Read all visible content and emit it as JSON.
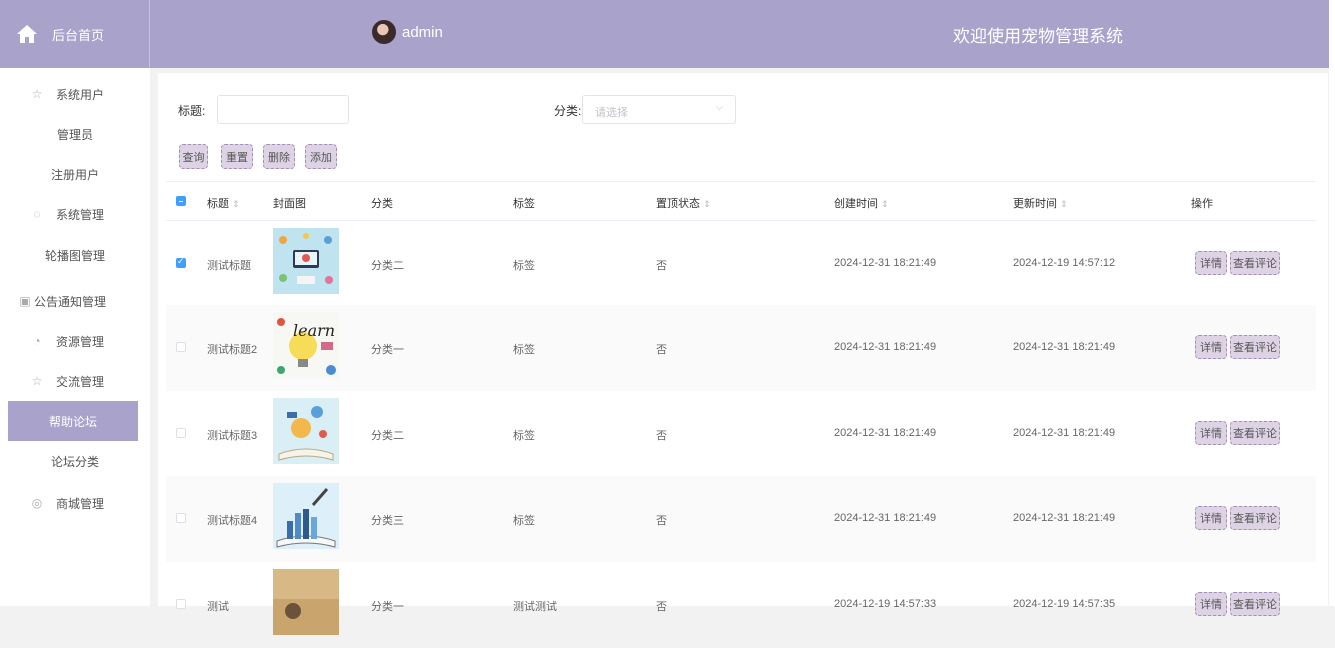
{
  "header": {
    "home_label": "后台首页",
    "username": "admin",
    "welcome": "欢迎使用宠物管理系统"
  },
  "sidebar": [
    {
      "label": "系统用户",
      "icon": "star-outline-icon",
      "kind": "top"
    },
    {
      "label": "管理员",
      "kind": "sub"
    },
    {
      "label": "注册用户",
      "kind": "sub"
    },
    {
      "label": "系统管理",
      "icon": "settings-icon",
      "kind": "top"
    },
    {
      "label": "轮播图管理",
      "kind": "sub"
    },
    {
      "label": "公告通知管理",
      "icon": "notice-icon",
      "kind": "notice"
    },
    {
      "label": "资源管理",
      "icon": "clock-icon",
      "kind": "top"
    },
    {
      "label": "交流管理",
      "icon": "star-outline-icon",
      "kind": "top"
    },
    {
      "label": "帮助论坛",
      "kind": "sub",
      "active": true
    },
    {
      "label": "论坛分类",
      "kind": "sub"
    },
    {
      "label": "商城管理",
      "icon": "compass-icon",
      "kind": "top"
    }
  ],
  "search": {
    "title_label": "标题:",
    "title_value": "",
    "category_label": "分类:",
    "category_placeholder": "请选择"
  },
  "buttons": {
    "query": "查询",
    "reset": "重置",
    "delete": "删除",
    "add": "添加"
  },
  "table": {
    "headers": {
      "title": "标题",
      "cover": "封面图",
      "category": "分类",
      "tags": "标签",
      "pinned": "置顶状态",
      "created": "创建时间",
      "updated": "更新时间",
      "actions": "操作"
    },
    "rows": [
      {
        "title": "测试标题",
        "category": "分类二",
        "tags": "标签",
        "pinned": "否",
        "created": "2024-12-31 18:21:49",
        "updated": "2024-12-19 14:57:12",
        "checked": true
      },
      {
        "title": "测试标题2",
        "category": "分类一",
        "tags": "标签",
        "pinned": "否",
        "created": "2024-12-31 18:21:49",
        "updated": "2024-12-31 18:21:49",
        "checked": false
      },
      {
        "title": "测试标题3",
        "category": "分类二",
        "tags": "标签",
        "pinned": "否",
        "created": "2024-12-31 18:21:49",
        "updated": "2024-12-31 18:21:49",
        "checked": false
      },
      {
        "title": "测试标题4",
        "category": "分类三",
        "tags": "标签",
        "pinned": "否",
        "created": "2024-12-31 18:21:49",
        "updated": "2024-12-31 18:21:49",
        "checked": false
      },
      {
        "title": "测试",
        "category": "分类一",
        "tags": "测试测试",
        "pinned": "否",
        "created": "2024-12-19 14:57:33",
        "updated": "2024-12-19 14:57:35",
        "checked": false
      }
    ],
    "detail_label": "详情",
    "comments_label": "查看评论"
  },
  "colors": {
    "accent": "#a9a3cc",
    "button_bg": "#ddd3e5",
    "checkbox": "#409eff"
  }
}
